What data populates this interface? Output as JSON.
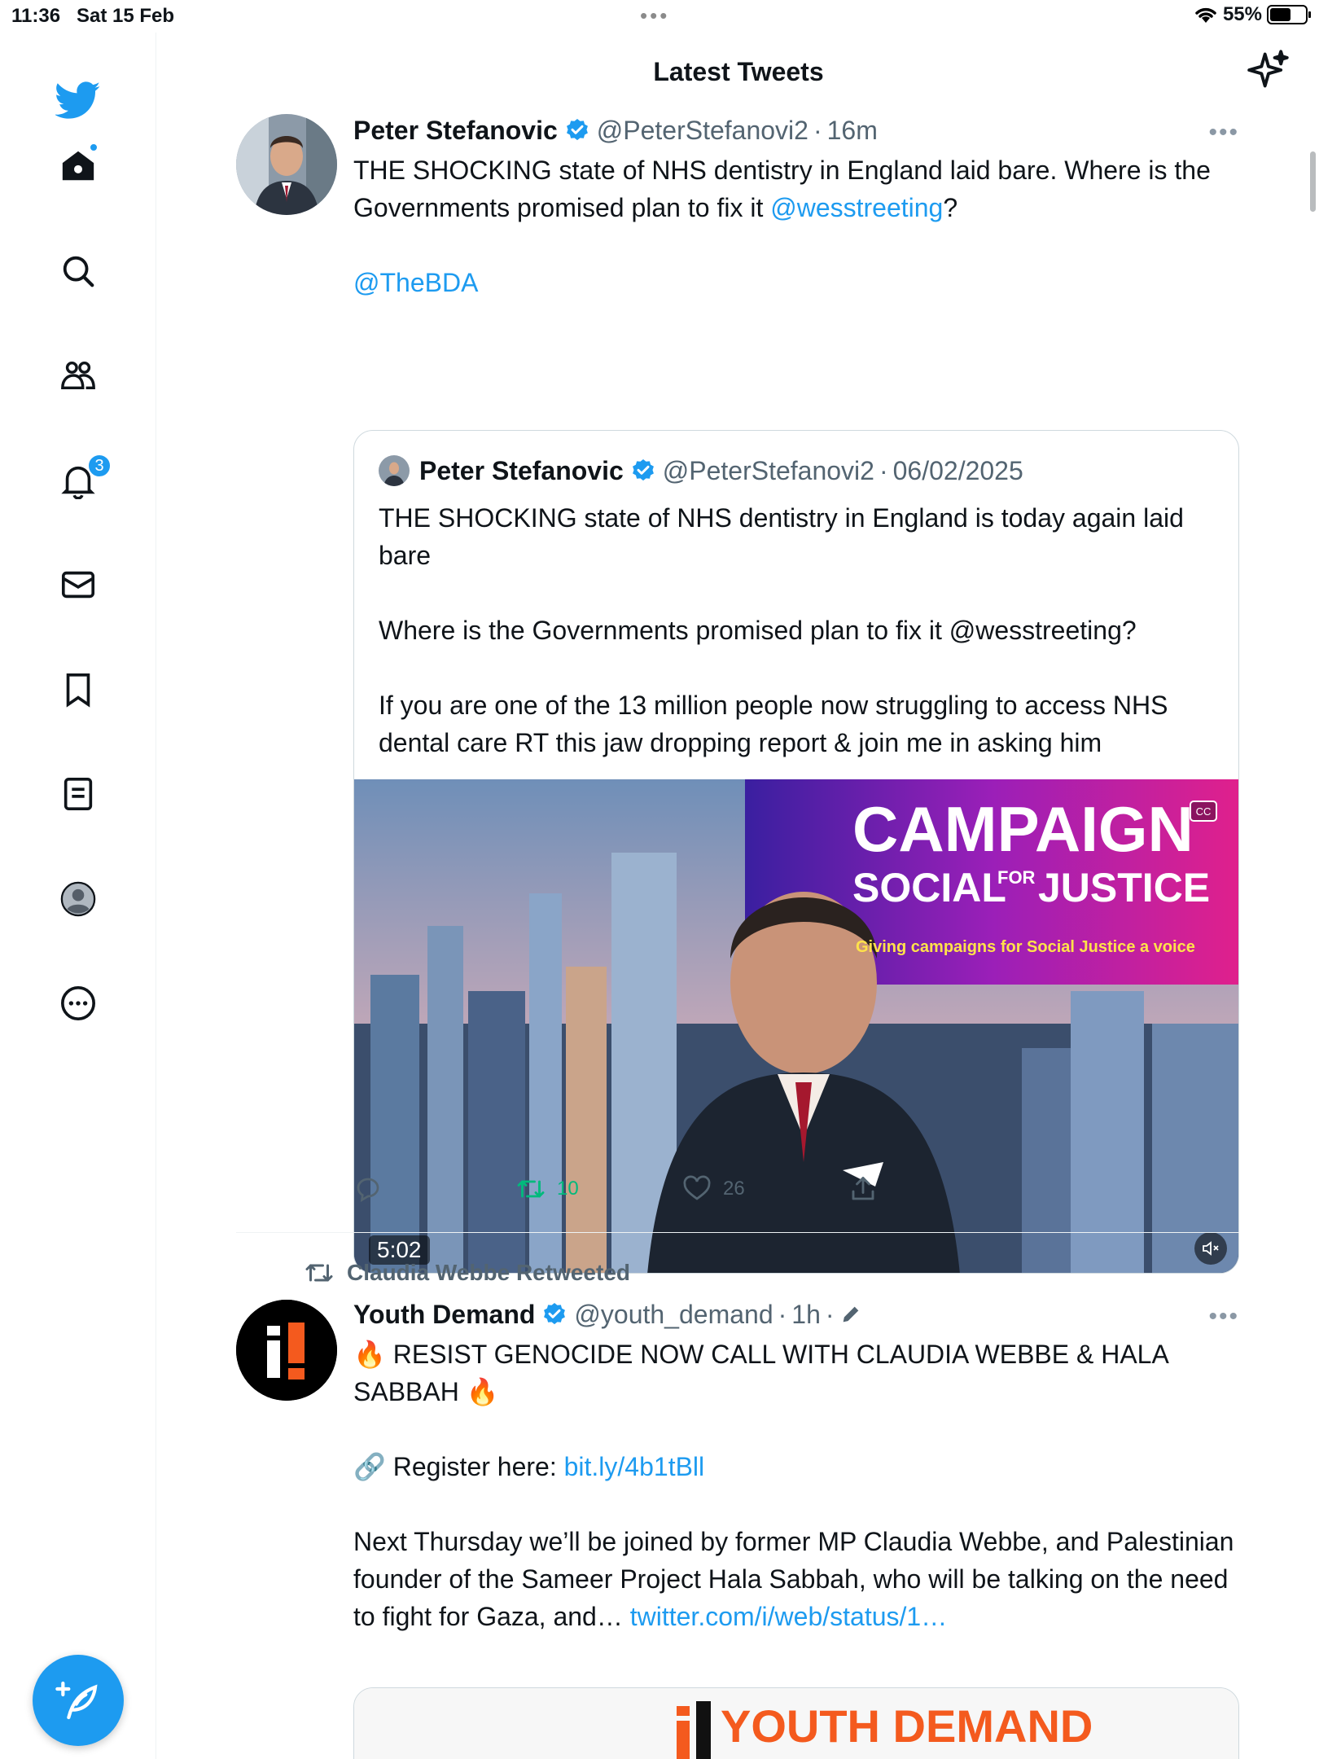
{
  "status_bar": {
    "time": "11:36",
    "date": "Sat 15 Feb",
    "battery": "55%"
  },
  "sidebar": {
    "items": [
      {
        "name": "home",
        "badge": ""
      },
      {
        "name": "search",
        "badge": ""
      },
      {
        "name": "communities",
        "badge": ""
      },
      {
        "name": "notifications",
        "badge": "3"
      },
      {
        "name": "messages",
        "badge": ""
      },
      {
        "name": "bookmarks",
        "badge": ""
      },
      {
        "name": "lists",
        "badge": ""
      },
      {
        "name": "profile",
        "badge": ""
      },
      {
        "name": "more",
        "badge": ""
      }
    ]
  },
  "header": {
    "title": "Latest Tweets"
  },
  "tweet1": {
    "name": "Peter Stefanovic",
    "handle": "@PeterStefanovi2",
    "sep": "·",
    "time": "16m",
    "text_before": "THE SHOCKING state of NHS dentistry in England laid bare. Where is the Governments promised plan to fix it ",
    "mention1": "@wesstreeting",
    "text_after": "?",
    "mention2": "@TheBDA",
    "quote": {
      "name": "Peter Stefanovic",
      "handle": "@PeterStefanovi2",
      "sep": "·",
      "date": "06/02/2025",
      "text": "THE SHOCKING state of NHS dentistry in England is today again laid bare\n\nWhere is the Governments promised plan to fix it @wesstreeting?\n\nIf you are one of the 13 million people now struggling to access NHS dental care RT this jaw dropping report & join me in asking him",
      "video": {
        "banner_line1": "CAMPAIGN",
        "banner_social": "SOCIAL",
        "banner_for": "FOR",
        "banner_justice": "JUSTICE",
        "banner_tagline": "Giving campaigns for Social Justice a voice",
        "duration": "5:02",
        "cc": "CC"
      }
    },
    "stats": {
      "replies": "",
      "retweets": "10",
      "likes": "26"
    }
  },
  "tweet2": {
    "retweeted_by": "Claudia Webbe Retweeted",
    "name": "Youth Demand",
    "handle": "@youth_demand",
    "sep": "·",
    "time": "1h",
    "sep2": "·",
    "line1": "🔥 RESIST GENOCIDE NOW CALL WITH CLAUDIA WEBBE & HALA SABBAH 🔥",
    "register_label": "🔗 Register here: ",
    "register_link": "bit.ly/4b1tBll",
    "body": "Next Thursday we’ll be joined by former MP Claudia Webbe, and Palestinian founder of the Sameer Project Hala Sabbah, who will be talking on the need to fight for Gaza, and… ",
    "body_link": "twitter.com/i/web/status/1…",
    "card_text": "YOUTH DEMAND",
    "avatar_text": "i!"
  },
  "colors": {
    "accent": "#1d9bf0",
    "retweet_green": "#00ba7c",
    "secondary": "#536471",
    "border": "#cfd9de"
  }
}
